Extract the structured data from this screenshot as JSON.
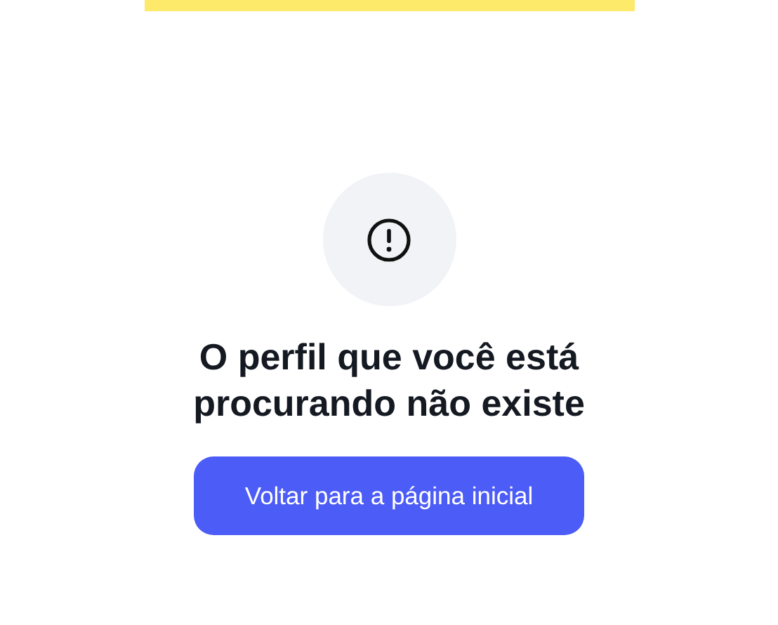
{
  "error": {
    "message": "O perfil que você está procurando não existe"
  },
  "button": {
    "label": "Voltar para a página inicial"
  }
}
